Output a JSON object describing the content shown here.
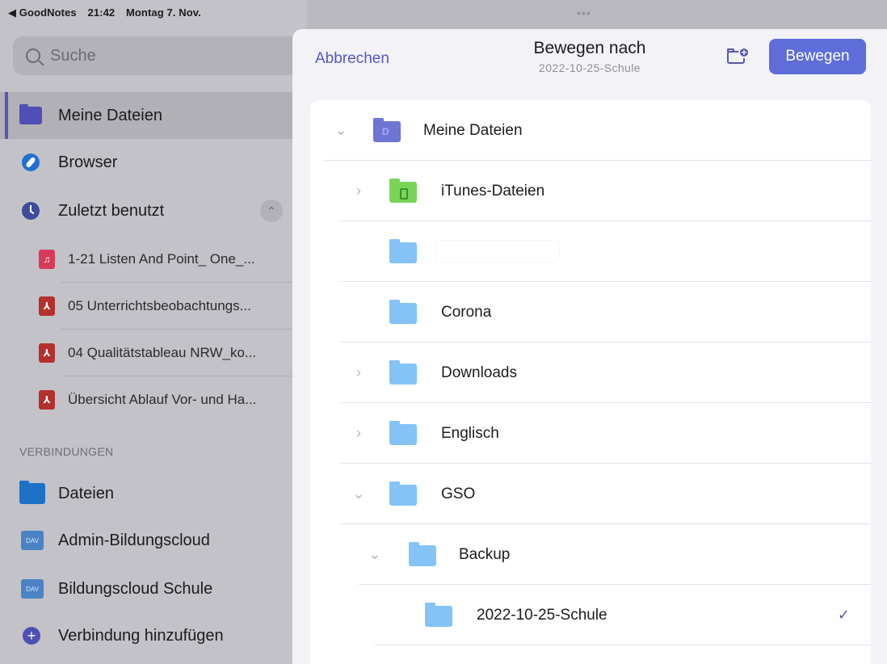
{
  "status_bar": {
    "back_app": "◀ GoodNotes",
    "time": "21:42",
    "date": "Montag 7. Nov."
  },
  "sidebar": {
    "search_placeholder": "Suche",
    "nav": [
      {
        "label": "Meine Dateien",
        "icon": "folder-icon",
        "active": true
      },
      {
        "label": "Browser",
        "icon": "compass-icon"
      },
      {
        "label": "Zuletzt benutzt",
        "icon": "clock-icon"
      }
    ],
    "recent": [
      {
        "label": "1-21 Listen And Point_ One_...",
        "icon": "music-file-icon"
      },
      {
        "label": "05 Unterrichtsbeobachtungs...",
        "icon": "pdf-file-icon"
      },
      {
        "label": "04 Qualitätstableau NRW_ko...",
        "icon": "pdf-file-icon"
      },
      {
        "label": "Übersicht Ablauf Vor- und Ha...",
        "icon": "pdf-file-icon"
      }
    ],
    "connections_title": "VERBINDUNGEN",
    "connections": [
      {
        "label": "Dateien",
        "icon": "files-folder-icon"
      },
      {
        "label": "Admin-Bildungscloud",
        "icon": "dav-folder-icon",
        "badge": "DAV"
      },
      {
        "label": "Bildungscloud Schule",
        "icon": "dav-folder-icon",
        "badge": "DAV"
      },
      {
        "label": "Verbindung hinzufügen",
        "icon": "plus-icon"
      }
    ]
  },
  "sheet": {
    "grabber": "•••",
    "cancel_label": "Abbrechen",
    "title": "Bewegen nach",
    "subtitle": "2022-10-25-Schule",
    "move_label": "Bewegen",
    "tree": [
      {
        "label": "Meine Dateien",
        "chevron": "down",
        "folder": "purple"
      },
      {
        "label": "iTunes-Dateien",
        "chevron": "right",
        "folder": "green"
      },
      {
        "label": "",
        "chevron": "",
        "folder": "blue",
        "redacted": true
      },
      {
        "label": "Corona",
        "chevron": "",
        "folder": "blue"
      },
      {
        "label": "Downloads",
        "chevron": "right",
        "folder": "blue"
      },
      {
        "label": "Englisch",
        "chevron": "right",
        "folder": "blue"
      },
      {
        "label": "GSO",
        "chevron": "down",
        "folder": "blue"
      },
      {
        "label": "Backup",
        "chevron": "down",
        "folder": "blue"
      },
      {
        "label": "2022-10-25-Schule",
        "chevron": "",
        "folder": "blue",
        "selected": true
      }
    ]
  },
  "colors": {
    "accent": "#5556b9",
    "button": "#5e6dd8",
    "folder_blue": "#85c3f7",
    "folder_green": "#79d458",
    "pdf_red": "#b2312f"
  }
}
